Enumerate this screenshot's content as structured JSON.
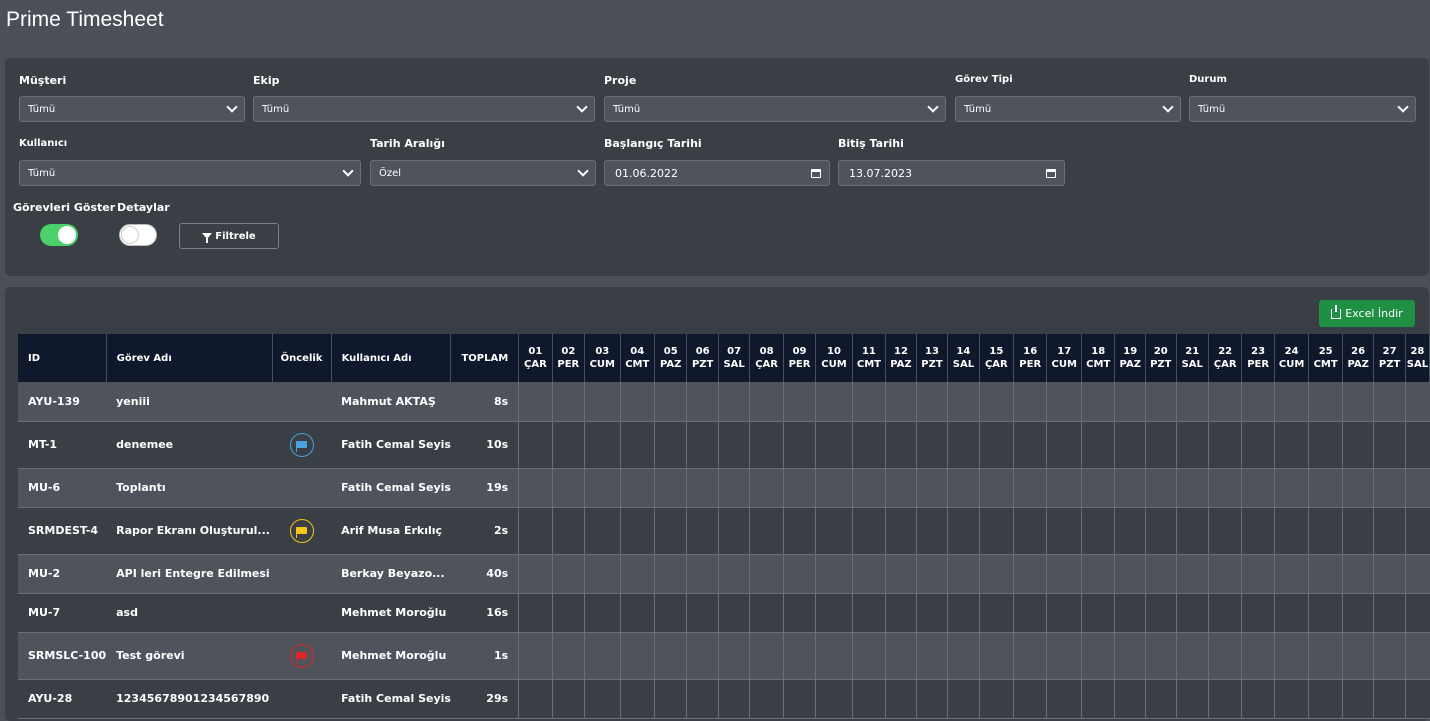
{
  "app": {
    "title": "Prime Timesheet"
  },
  "filters": {
    "musteri": {
      "label": "Müşteri",
      "value": "Tümü"
    },
    "ekip": {
      "label": "Ekip",
      "value": "Tümü"
    },
    "proje": {
      "label": "Proje",
      "value": "Tümü"
    },
    "gorev_tipi": {
      "label": "Görev Tipi",
      "value": "Tümü"
    },
    "durum": {
      "label": "Durum",
      "value": "Tümü"
    },
    "kullanici": {
      "label": "Kullanıcı",
      "value": "Tümü"
    },
    "tarih_araligi": {
      "label": "Tarih Aralığı",
      "value": "Özel"
    },
    "baslangic": {
      "label": "Başlangıç Tarihi",
      "value": "01.06.2022"
    },
    "bitis": {
      "label": "Bitiş Tarihi",
      "value": "13.07.2023"
    },
    "gorevleri_goster": {
      "label": "Görevleri Göster",
      "on": true
    },
    "detaylar": {
      "label": "Detaylar",
      "on": false
    },
    "filtrele_label": "Filtrele"
  },
  "export": {
    "label": "Excel İndir"
  },
  "table": {
    "headers": {
      "id": "ID",
      "gorev_adi": "Görev Adı",
      "oncelik": "Öncelik",
      "kullanici_adi": "Kullanıcı Adı",
      "toplam": "TOPLAM"
    },
    "days": [
      {
        "d": "01",
        "w": "ÇAR"
      },
      {
        "d": "02",
        "w": "PER"
      },
      {
        "d": "03",
        "w": "CUM"
      },
      {
        "d": "04",
        "w": "CMT"
      },
      {
        "d": "05",
        "w": "PAZ"
      },
      {
        "d": "06",
        "w": "PZT"
      },
      {
        "d": "07",
        "w": "SAL"
      },
      {
        "d": "08",
        "w": "ÇAR"
      },
      {
        "d": "09",
        "w": "PER"
      },
      {
        "d": "10",
        "w": "CUM"
      },
      {
        "d": "11",
        "w": "CMT"
      },
      {
        "d": "12",
        "w": "PAZ"
      },
      {
        "d": "13",
        "w": "PZT"
      },
      {
        "d": "14",
        "w": "SAL"
      },
      {
        "d": "15",
        "w": "ÇAR"
      },
      {
        "d": "16",
        "w": "PER"
      },
      {
        "d": "17",
        "w": "CUM"
      },
      {
        "d": "18",
        "w": "CMT"
      },
      {
        "d": "19",
        "w": "PAZ"
      },
      {
        "d": "20",
        "w": "PZT"
      },
      {
        "d": "21",
        "w": "SAL"
      },
      {
        "d": "22",
        "w": "ÇAR"
      },
      {
        "d": "23",
        "w": "PER"
      },
      {
        "d": "24",
        "w": "CUM"
      },
      {
        "d": "25",
        "w": "CMT"
      },
      {
        "d": "26",
        "w": "PAZ"
      },
      {
        "d": "27",
        "w": "PZT"
      },
      {
        "d": "28",
        "w": "SAL"
      }
    ],
    "rows": [
      {
        "id": "AYU-139",
        "gorev": "yeniii",
        "priority": null,
        "kullanici": "Mahmut AKTAŞ",
        "toplam": "8s"
      },
      {
        "id": "MT-1",
        "gorev": "denemee",
        "priority": "blue",
        "kullanici": "Fatih Cemal Seyis",
        "toplam": "10s"
      },
      {
        "id": "MU-6",
        "gorev": "Toplantı",
        "priority": null,
        "kullanici": "Fatih Cemal Seyis",
        "toplam": "19s"
      },
      {
        "id": "SRMDEST-4",
        "gorev": "Rapor Ekranı Oluşturul...",
        "priority": "yellow",
        "kullanici": "Arif Musa Erkılıç",
        "toplam": "2s"
      },
      {
        "id": "MU-2",
        "gorev": "API leri Entegre Edilmesi",
        "priority": null,
        "kullanici": "Berkay Beyazo...",
        "toplam": "40s"
      },
      {
        "id": "MU-7",
        "gorev": "asd",
        "priority": null,
        "kullanici": "Mehmet Moroğlu",
        "toplam": "16s"
      },
      {
        "id": "SRMSLC-100",
        "gorev": "Test görevi",
        "priority": "red",
        "kullanici": "Mehmet Moroğlu",
        "toplam": "1s"
      },
      {
        "id": "AYU-28",
        "gorev": "12345678901234567890",
        "priority": null,
        "kullanici": "Fatih Cemal Seyis",
        "toplam": "29s"
      }
    ]
  },
  "colors": {
    "priority_blue": "#4aa3df",
    "priority_yellow": "#f5c518",
    "priority_red": "#e02424",
    "accent_green": "#1f8f43"
  }
}
